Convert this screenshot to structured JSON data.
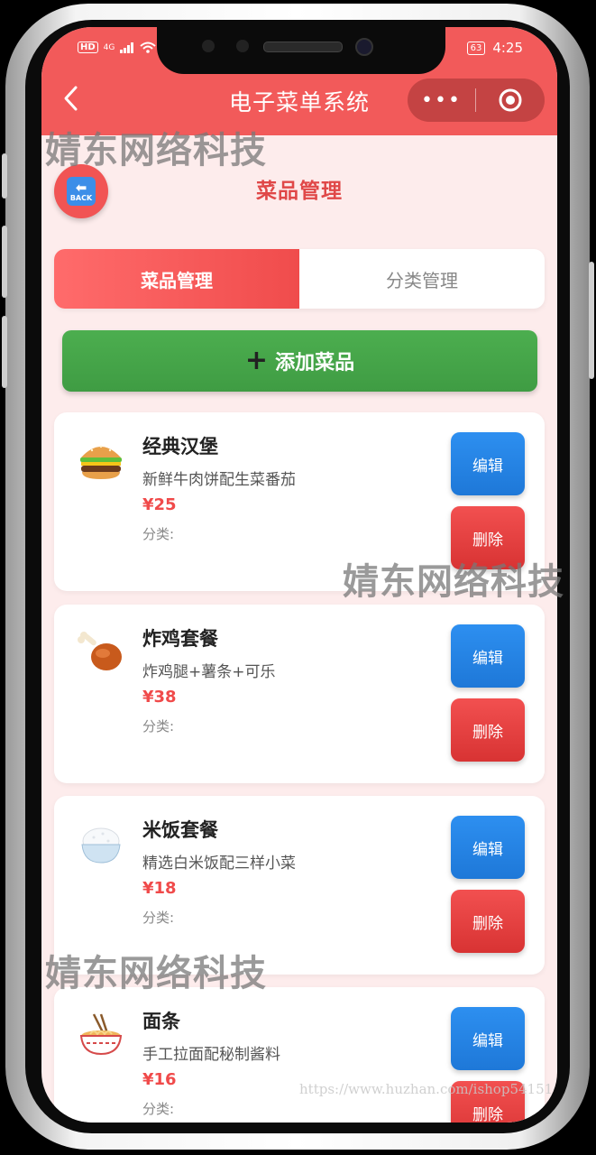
{
  "status": {
    "left": {
      "hd": "HD",
      "net": "4G"
    },
    "battery": "63",
    "time": "4:25"
  },
  "nav": {
    "title": "电子菜单系统",
    "more_symbol": "•••"
  },
  "page": {
    "title": "菜品管理",
    "back_badge": "BACK"
  },
  "tabs": [
    {
      "label": "菜品管理",
      "active": true
    },
    {
      "label": "分类管理",
      "active": false
    }
  ],
  "add_button": {
    "label": "添加菜品"
  },
  "dishes": [
    {
      "icon": "hamburger-icon",
      "name": "经典汉堡",
      "desc": "新鲜牛肉饼配生菜番茄",
      "price": "¥25",
      "category": "分类:"
    },
    {
      "icon": "drumstick-icon",
      "name": "炸鸡套餐",
      "desc": "炸鸡腿+薯条+可乐",
      "price": "¥38",
      "category": "分类:"
    },
    {
      "icon": "rice-bowl-icon",
      "name": "米饭套餐",
      "desc": "精选白米饭配三样小菜",
      "price": "¥18",
      "category": "分类:"
    },
    {
      "icon": "noodle-bowl-icon",
      "name": "面条",
      "desc": "手工拉面配秘制酱料",
      "price": "¥16",
      "category": "分类:"
    }
  ],
  "actions": {
    "edit": "编辑",
    "delete": "删除"
  },
  "watermarks": {
    "text": "婧东网络科技",
    "url": "https://www.huzhan.com/ishop54151"
  },
  "colors": {
    "primary_red": "#f25a5a",
    "green": "#4cae4f",
    "blue": "#2d8ff0",
    "price": "#f04a4a"
  }
}
